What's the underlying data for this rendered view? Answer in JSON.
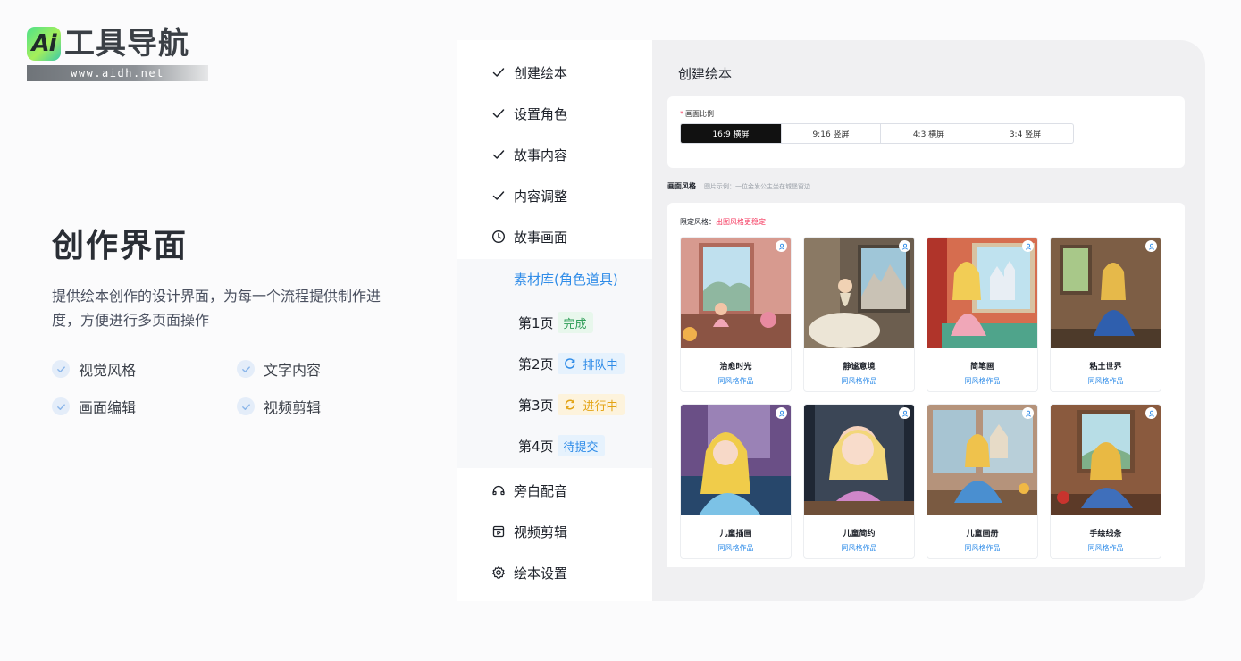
{
  "brand": {
    "mark": "Ai",
    "title": "工具导航",
    "url": "www.aidh.net"
  },
  "intro": {
    "title": "创作界面",
    "description": "提供绘本创作的设计界面，为每一个流程提供制作进度，方便进行多页面操作",
    "features": [
      "视觉风格",
      "文字内容",
      "画面编辑",
      "视频剪辑"
    ]
  },
  "sidebar": {
    "steps": [
      {
        "label": "创建绘本",
        "icon": "check-icon"
      },
      {
        "label": "设置角色",
        "icon": "check-icon"
      },
      {
        "label": "故事内容",
        "icon": "check-icon"
      },
      {
        "label": "内容调整",
        "icon": "check-icon"
      },
      {
        "label": "故事画面",
        "icon": "clock-icon"
      }
    ],
    "sub_active": "素材库(角色道具)",
    "pages": [
      {
        "label": "第1页",
        "status": "完成"
      },
      {
        "label": "第2页",
        "status": "排队中"
      },
      {
        "label": "第3页",
        "status": "进行中"
      },
      {
        "label": "第4页",
        "status": "待提交"
      }
    ],
    "bottom": [
      {
        "label": "旁白配音",
        "icon": "headphones-icon"
      },
      {
        "label": "视频剪辑",
        "icon": "video-edit-icon"
      },
      {
        "label": "绘本设置",
        "icon": "gear-icon"
      }
    ]
  },
  "main": {
    "title": "创建绘本",
    "ratio_label": "画面比例",
    "ratio_required": "*",
    "ratios": [
      "16:9 横屏",
      "9:16 竖屏",
      "4:3 横屏",
      "3:4 竖屏"
    ],
    "ratio_selected": "16:9 横屏",
    "style_heading": "画面风格",
    "style_hint": "图片示例：一位金发公主坐在城堡窗边",
    "limit_label": "限定风格：",
    "limit_value": "出图风格更稳定",
    "styles": [
      {
        "name": "治愈时光",
        "sub": "同风格作品"
      },
      {
        "name": "静谧意境",
        "sub": "同风格作品"
      },
      {
        "name": "简笔画",
        "sub": "同风格作品"
      },
      {
        "name": "粘土世界",
        "sub": "同风格作品"
      },
      {
        "name": "儿童插画",
        "sub": "同风格作品"
      },
      {
        "name": "儿童简约",
        "sub": "同风格作品"
      },
      {
        "name": "儿童画册",
        "sub": "同风格作品"
      },
      {
        "name": "手绘线条",
        "sub": "同风格作品"
      }
    ]
  },
  "colors": {
    "accent": "#2f8ce8",
    "highlight": "#f5365c",
    "done": "#2e9d57",
    "progress": "#e3a313"
  }
}
